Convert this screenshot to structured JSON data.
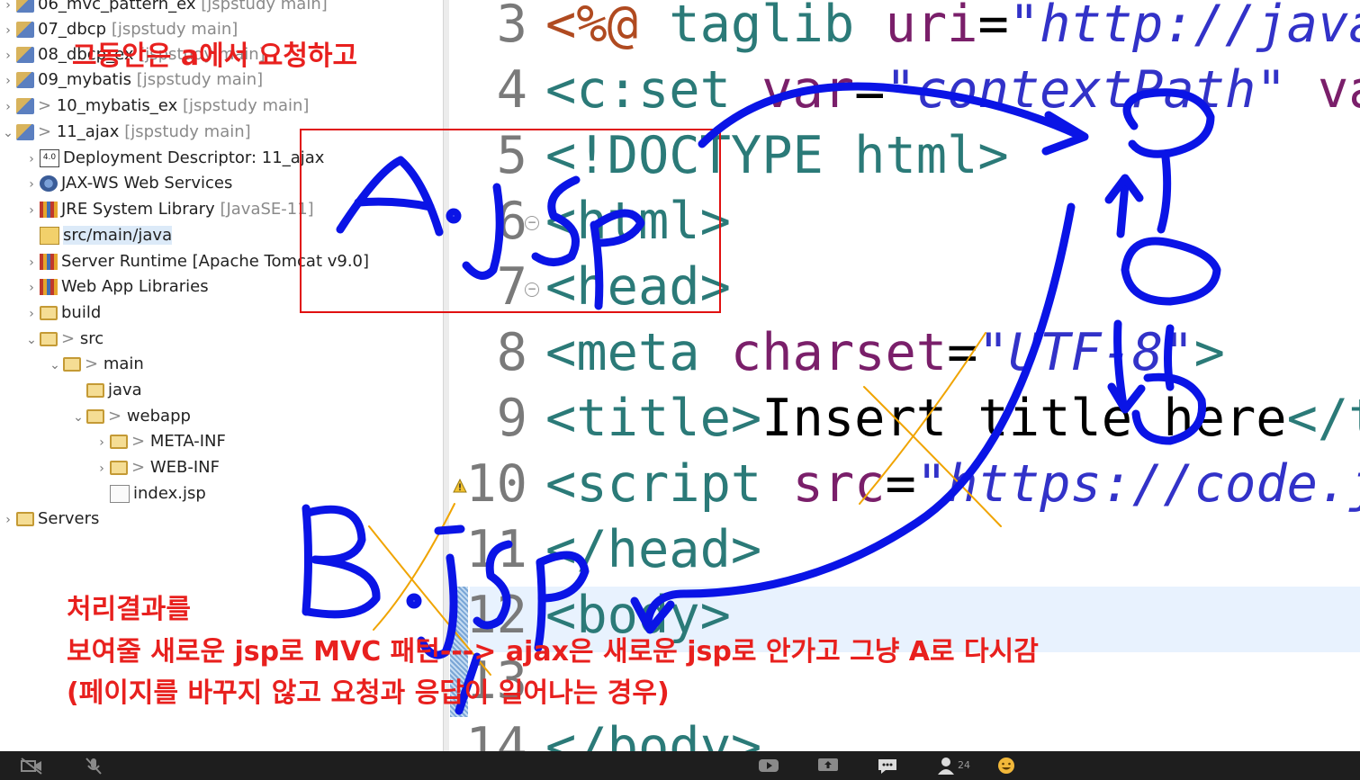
{
  "explorer": {
    "items": [
      {
        "label": "06_mvc_pattern_ex",
        "suffix": "[jspstudy main]",
        "prefix": ""
      },
      {
        "label": "07_dbcp",
        "suffix": "[jspstudy main]",
        "prefix": ""
      },
      {
        "label": "08_dbcp_ex",
        "suffix": "[jspstudy main]",
        "prefix": ""
      },
      {
        "label": "09_mybatis",
        "suffix": "[jspstudy main]",
        "prefix": ""
      },
      {
        "label": "10_mybatis_ex",
        "suffix": "[jspstudy main]",
        "prefix": ">"
      },
      {
        "label": "11_ajax",
        "suffix": "[jspstudy main]",
        "prefix": ">"
      },
      {
        "label": "Deployment Descriptor: 11_ajax",
        "suffix": "",
        "prefix": ""
      },
      {
        "label": "JAX-WS Web Services",
        "suffix": "",
        "prefix": ""
      },
      {
        "label": "JRE System Library",
        "suffix": "[JavaSE-11]",
        "prefix": ""
      },
      {
        "label": "src/main/java",
        "suffix": "",
        "prefix": ""
      },
      {
        "label": "Server Runtime [Apache Tomcat v9.0]",
        "suffix": "",
        "prefix": ""
      },
      {
        "label": "Web App Libraries",
        "suffix": "",
        "prefix": ""
      },
      {
        "label": "build",
        "suffix": "",
        "prefix": ""
      },
      {
        "label": "src",
        "suffix": "",
        "prefix": ">"
      },
      {
        "label": "main",
        "suffix": "",
        "prefix": ">"
      },
      {
        "label": "java",
        "suffix": "",
        "prefix": ""
      },
      {
        "label": "webapp",
        "suffix": "",
        "prefix": ">"
      },
      {
        "label": "META-INF",
        "suffix": "",
        "prefix": ">"
      },
      {
        "label": "WEB-INF",
        "suffix": "",
        "prefix": ">"
      },
      {
        "label": "index.jsp",
        "suffix": "",
        "prefix": ""
      },
      {
        "label": "Servers",
        "suffix": "",
        "prefix": ""
      }
    ]
  },
  "editor": {
    "lines": [
      {
        "num": "3",
        "parts": [
          [
            "c-dir",
            "<%@ "
          ],
          [
            "c-tag",
            "taglib "
          ],
          [
            "c-attr",
            "uri"
          ],
          [
            "c-txt",
            "="
          ],
          [
            "c-str",
            "\"http://java.s"
          ]
        ]
      },
      {
        "num": "4",
        "parts": [
          [
            "c-tag",
            "<c:set "
          ],
          [
            "c-attr",
            "var"
          ],
          [
            "c-txt",
            "="
          ],
          [
            "c-str",
            "\"contextPath\" "
          ],
          [
            "c-attr",
            "valu"
          ]
        ]
      },
      {
        "num": "5",
        "parts": [
          [
            "c-tag",
            "<!DOCTYPE html>"
          ]
        ]
      },
      {
        "num": "6",
        "parts": [
          [
            "c-tag",
            "<html>"
          ]
        ]
      },
      {
        "num": "7",
        "parts": [
          [
            "c-tag",
            "<head>"
          ]
        ]
      },
      {
        "num": "8",
        "parts": [
          [
            "c-tag",
            "<meta "
          ],
          [
            "c-attr",
            "charset"
          ],
          [
            "c-txt",
            "="
          ],
          [
            "c-str",
            "\"UTF-8\""
          ],
          [
            "c-tag",
            ">"
          ]
        ]
      },
      {
        "num": "9",
        "parts": [
          [
            "c-tag",
            "<title>"
          ],
          [
            "c-txt",
            "Insert title here"
          ],
          [
            "c-tag",
            "</tit"
          ]
        ]
      },
      {
        "num": "10",
        "parts": [
          [
            "c-tag",
            "<script "
          ],
          [
            "c-attr",
            "src"
          ],
          [
            "c-txt",
            "="
          ],
          [
            "c-str",
            "\"https://code.jqu"
          ]
        ]
      },
      {
        "num": "11",
        "parts": [
          [
            "c-tag",
            "</head>"
          ]
        ]
      },
      {
        "num": "12",
        "parts": [
          [
            "c-tag",
            "<body>"
          ]
        ]
      },
      {
        "num": "13",
        "parts": [
          [
            "c-txt",
            ""
          ]
        ]
      },
      {
        "num": "14",
        "parts": [
          [
            "c-tag",
            "</body>"
          ]
        ]
      }
    ]
  },
  "annotations": {
    "note_top": "그동안은 a에서 요청하고",
    "note_bottom_1": "처리결과를",
    "note_bottom_2": "보여줄 새로운 jsp로 MVC 패턴---> ajax은 새로운 jsp로 안가고 그냥 A로 다시감",
    "note_bottom_3": "(페이지를 바꾸지 않고 요청과 응답이 일어나는 경우)"
  },
  "taskbar": {
    "participant_count": "24"
  },
  "colors": {
    "scribble_blue": "#0a14e6",
    "scribble_orange": "#f0a400",
    "annotation_red": "#e8201e"
  }
}
